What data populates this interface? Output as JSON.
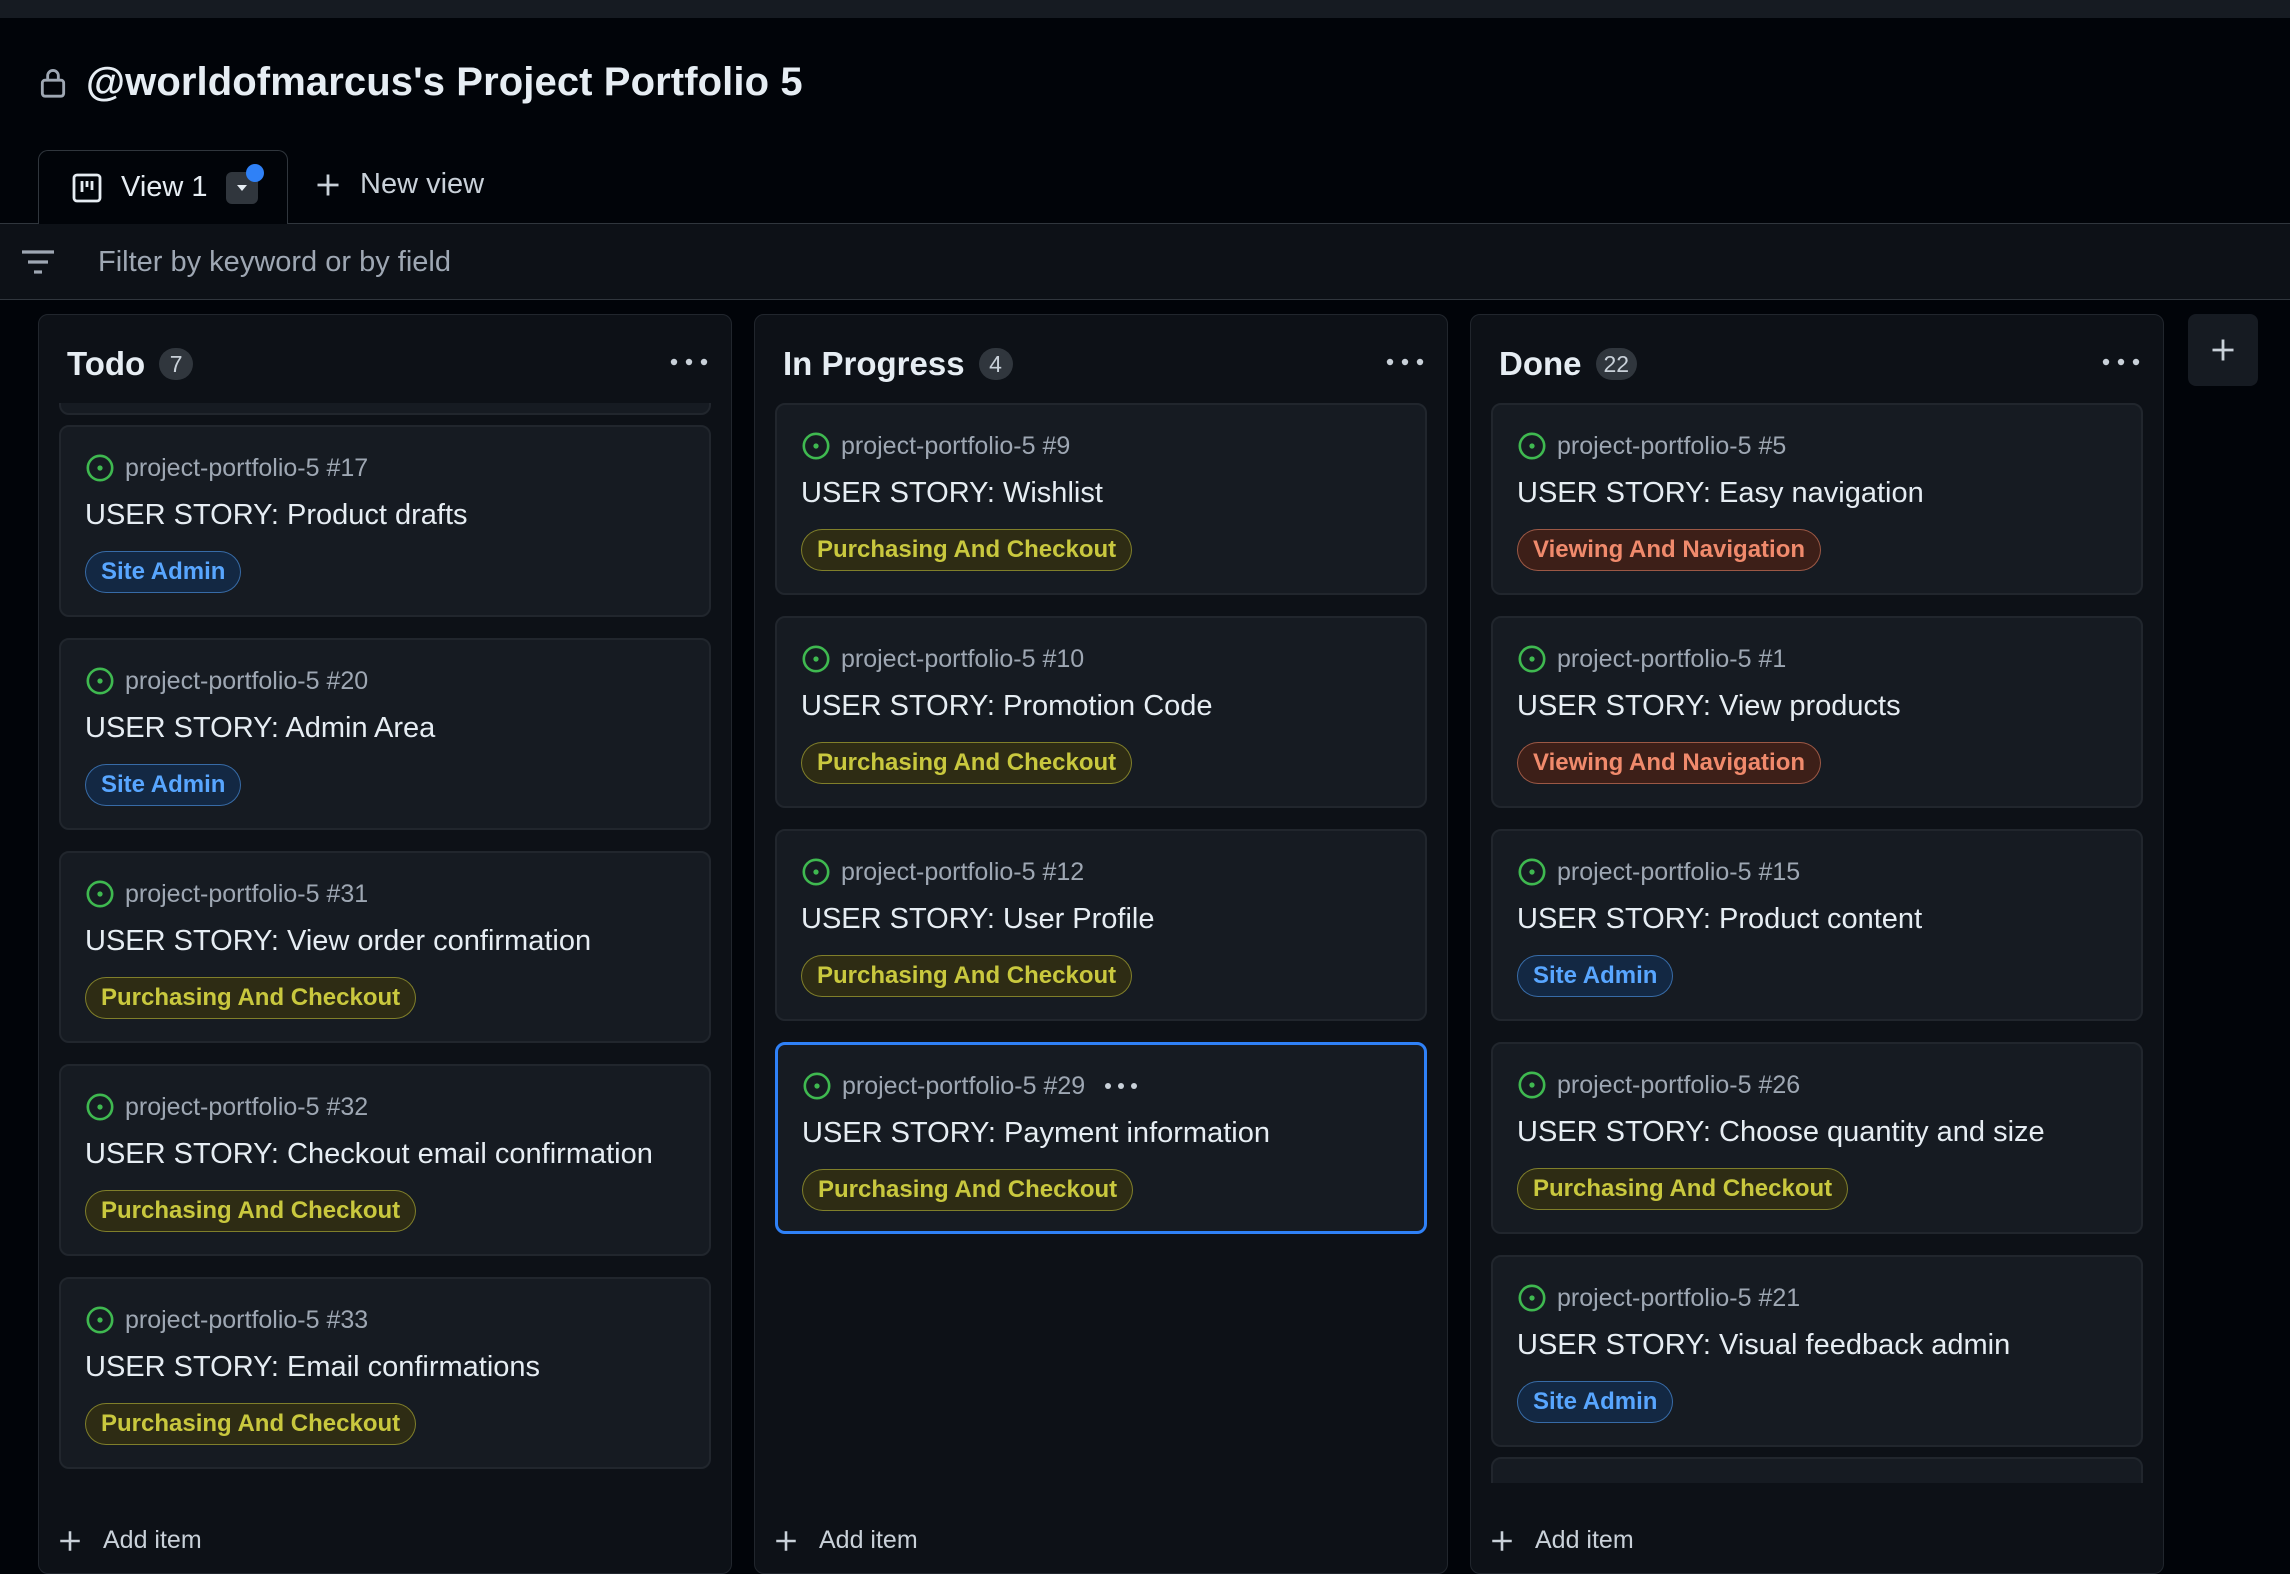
{
  "app": {
    "title": "@worldofmarcus's Project Portfolio 5"
  },
  "tabs": {
    "active_label": "View 1",
    "new_view_label": "New view"
  },
  "filter": {
    "placeholder": "Filter by keyword or by field"
  },
  "colors": {
    "accent": "#2f81f7",
    "open_issue": "#3fb950",
    "label_purchasing_text": "#c9c83e",
    "label_purchasing_bg": "#2e2c14",
    "label_site_admin_text": "#58a6ff",
    "label_site_admin_bg": "#132843",
    "label_viewing_text": "#f08a6c",
    "label_viewing_bg": "#3d1f18"
  },
  "columns": [
    {
      "name": "Todo",
      "count": "7",
      "add_item_label": "Add item",
      "cards": [
        {
          "ref": "project-portfolio-5 #17",
          "title": "USER STORY: Product drafts",
          "label": "Site Admin",
          "label_kind": "site-admin",
          "selected": false
        },
        {
          "ref": "project-portfolio-5 #20",
          "title": "USER STORY: Admin Area",
          "label": "Site Admin",
          "label_kind": "site-admin",
          "selected": false
        },
        {
          "ref": "project-portfolio-5 #31",
          "title": "USER STORY: View order confirmation",
          "label": "Purchasing And Checkout",
          "label_kind": "purchasing",
          "selected": false
        },
        {
          "ref": "project-portfolio-5 #32",
          "title": "USER STORY: Checkout email confirmation",
          "label": "Purchasing And Checkout",
          "label_kind": "purchasing",
          "selected": false
        },
        {
          "ref": "project-portfolio-5 #33",
          "title": "USER STORY: Email confirmations",
          "label": "Purchasing And Checkout",
          "label_kind": "purchasing",
          "selected": false
        }
      ]
    },
    {
      "name": "In Progress",
      "count": "4",
      "add_item_label": "Add item",
      "cards": [
        {
          "ref": "project-portfolio-5 #9",
          "title": "USER STORY: Wishlist",
          "label": "Purchasing And Checkout",
          "label_kind": "purchasing",
          "selected": false
        },
        {
          "ref": "project-portfolio-5 #10",
          "title": "USER STORY: Promotion Code",
          "label": "Purchasing And Checkout",
          "label_kind": "purchasing",
          "selected": false
        },
        {
          "ref": "project-portfolio-5 #12",
          "title": "USER STORY: User Profile",
          "label": "Purchasing And Checkout",
          "label_kind": "purchasing",
          "selected": false
        },
        {
          "ref": "project-portfolio-5 #29",
          "title": "USER STORY: Payment information",
          "label": "Purchasing And Checkout",
          "label_kind": "purchasing",
          "selected": true
        }
      ]
    },
    {
      "name": "Done",
      "count": "22",
      "add_item_label": "Add item",
      "cards": [
        {
          "ref": "project-portfolio-5 #5",
          "title": "USER STORY: Easy navigation",
          "label": "Viewing And Navigation",
          "label_kind": "viewing",
          "selected": false
        },
        {
          "ref": "project-portfolio-5 #1",
          "title": "USER STORY: View products",
          "label": "Viewing And Navigation",
          "label_kind": "viewing",
          "selected": false
        },
        {
          "ref": "project-portfolio-5 #15",
          "title": "USER STORY: Product content",
          "label": "Site Admin",
          "label_kind": "site-admin",
          "selected": false
        },
        {
          "ref": "project-portfolio-5 #26",
          "title": "USER STORY: Choose quantity and size",
          "label": "Purchasing And Checkout",
          "label_kind": "purchasing",
          "selected": false
        },
        {
          "ref": "project-portfolio-5 #21",
          "title": "USER STORY: Visual feedback admin",
          "label": "Site Admin",
          "label_kind": "site-admin",
          "selected": false
        }
      ]
    }
  ]
}
